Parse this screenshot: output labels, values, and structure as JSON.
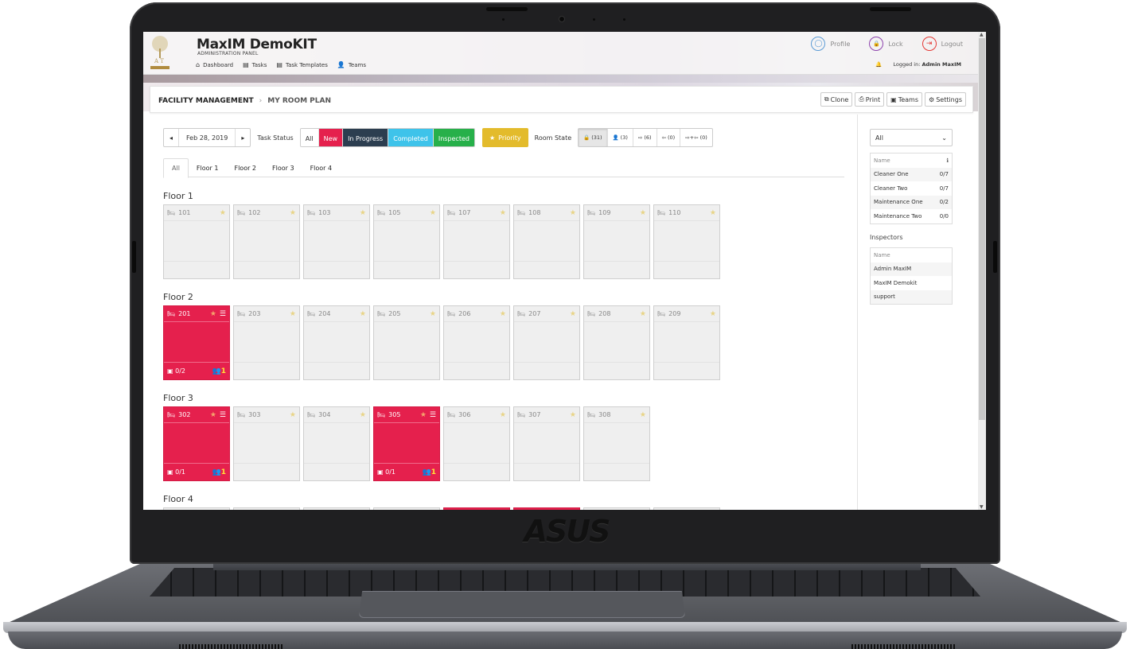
{
  "device": {
    "brand_logo": "ASUS"
  },
  "app": {
    "title": "MaxIM DemoKIT",
    "subtitle": "ADMINISTRATION PANEL",
    "nav": [
      {
        "icon": "home-icon",
        "glyph": "⌂",
        "label": "Dashboard"
      },
      {
        "icon": "tasks-icon",
        "glyph": "▤",
        "label": "Tasks"
      },
      {
        "icon": "task-templates-icon",
        "glyph": "▤",
        "label": "Task Templates"
      },
      {
        "icon": "teams-icon",
        "glyph": "👤",
        "label": "Teams"
      }
    ],
    "top_links": [
      {
        "name": "profile",
        "label": "Profile",
        "glyph": "◯",
        "color": "#5b9bd5"
      },
      {
        "name": "lock",
        "label": "Lock",
        "glyph": "🔒",
        "color": "#8e44ad"
      },
      {
        "name": "logout",
        "label": "Logout",
        "glyph": "⇥",
        "color": "#e53935"
      }
    ],
    "logged_in_prefix": "Logged in:",
    "logged_in_user": "Admin MaxIM"
  },
  "breadcrumb": {
    "root": "FACILITY MANAGEMENT",
    "separator": "›",
    "current": "MY ROOM PLAN"
  },
  "toolbar": {
    "clone": "Clone",
    "print": "Print",
    "teams": "Teams",
    "settings": "Settings"
  },
  "filters": {
    "prev": "◂",
    "next": "▸",
    "date": "Feb 28, 2019",
    "task_status_label": "Task Status",
    "statuses": [
      {
        "label": "All",
        "color": "#ffffff",
        "text": "#333333"
      },
      {
        "label": "New",
        "color": "#e5204d",
        "text": "#ffffff"
      },
      {
        "label": "In Progress",
        "color": "#2c3e50",
        "text": "#ffffff"
      },
      {
        "label": "Completed",
        "color": "#3ec3ea",
        "text": "#ffffff"
      },
      {
        "label": "Inspected",
        "color": "#27b04a",
        "text": "#ffffff"
      }
    ],
    "priority": "Priority",
    "room_state_label": "Room State",
    "room_states": [
      {
        "glyph": "🔒",
        "label": "(31)",
        "active": true
      },
      {
        "glyph": "👤",
        "label": "(3)",
        "active": false
      },
      {
        "glyph": "⇨",
        "label": "(6)",
        "active": false
      },
      {
        "glyph": "⇦",
        "label": "(0)",
        "active": false
      },
      {
        "glyph": "⇨+⇦",
        "label": "(0)",
        "active": false
      }
    ]
  },
  "tabs": [
    "All",
    "Floor 1",
    "Floor 2",
    "Floor 3",
    "Floor 4"
  ],
  "active_tab": "All",
  "floors": [
    {
      "title": "Floor 1",
      "rooms": [
        {
          "number": "101"
        },
        {
          "number": "102"
        },
        {
          "number": "103"
        },
        {
          "number": "105"
        },
        {
          "number": "107"
        },
        {
          "number": "108"
        },
        {
          "number": "109"
        },
        {
          "number": "110"
        }
      ]
    },
    {
      "title": "Floor 2",
      "rooms": [
        {
          "number": "201",
          "status": "new",
          "tasks": "0/2",
          "people": "1"
        },
        {
          "number": "203"
        },
        {
          "number": "204"
        },
        {
          "number": "205"
        },
        {
          "number": "206"
        },
        {
          "number": "207"
        },
        {
          "number": "208"
        },
        {
          "number": "209"
        }
      ]
    },
    {
      "title": "Floor 3",
      "rooms": [
        {
          "number": "302",
          "status": "new",
          "tasks": "0/1",
          "people": "1"
        },
        {
          "number": "303"
        },
        {
          "number": "304"
        },
        {
          "number": "305",
          "status": "new",
          "tasks": "0/1",
          "people": "1"
        },
        {
          "number": "306"
        },
        {
          "number": "307"
        },
        {
          "number": "308"
        }
      ]
    },
    {
      "title": "Floor 4",
      "rooms": [
        {
          "status": ""
        },
        {
          "status": ""
        },
        {
          "status": ""
        },
        {
          "status": ""
        },
        {
          "status": "new"
        },
        {
          "status": "new"
        },
        {
          "status": ""
        },
        {
          "status": ""
        }
      ]
    }
  ],
  "sidebar": {
    "team_select": "All",
    "staff_header": "Name",
    "staff": [
      {
        "name": "Cleaner One",
        "count": "0/7"
      },
      {
        "name": "Cleaner Two",
        "count": "0/7"
      },
      {
        "name": "Maintenance One",
        "count": "0/2"
      },
      {
        "name": "Maintenance Two",
        "count": "0/0"
      }
    ],
    "inspectors_title": "Inspectors",
    "inspectors_header": "Name",
    "inspectors": [
      "Admin MaxIM",
      "MaxIM Demokit",
      "support"
    ]
  }
}
